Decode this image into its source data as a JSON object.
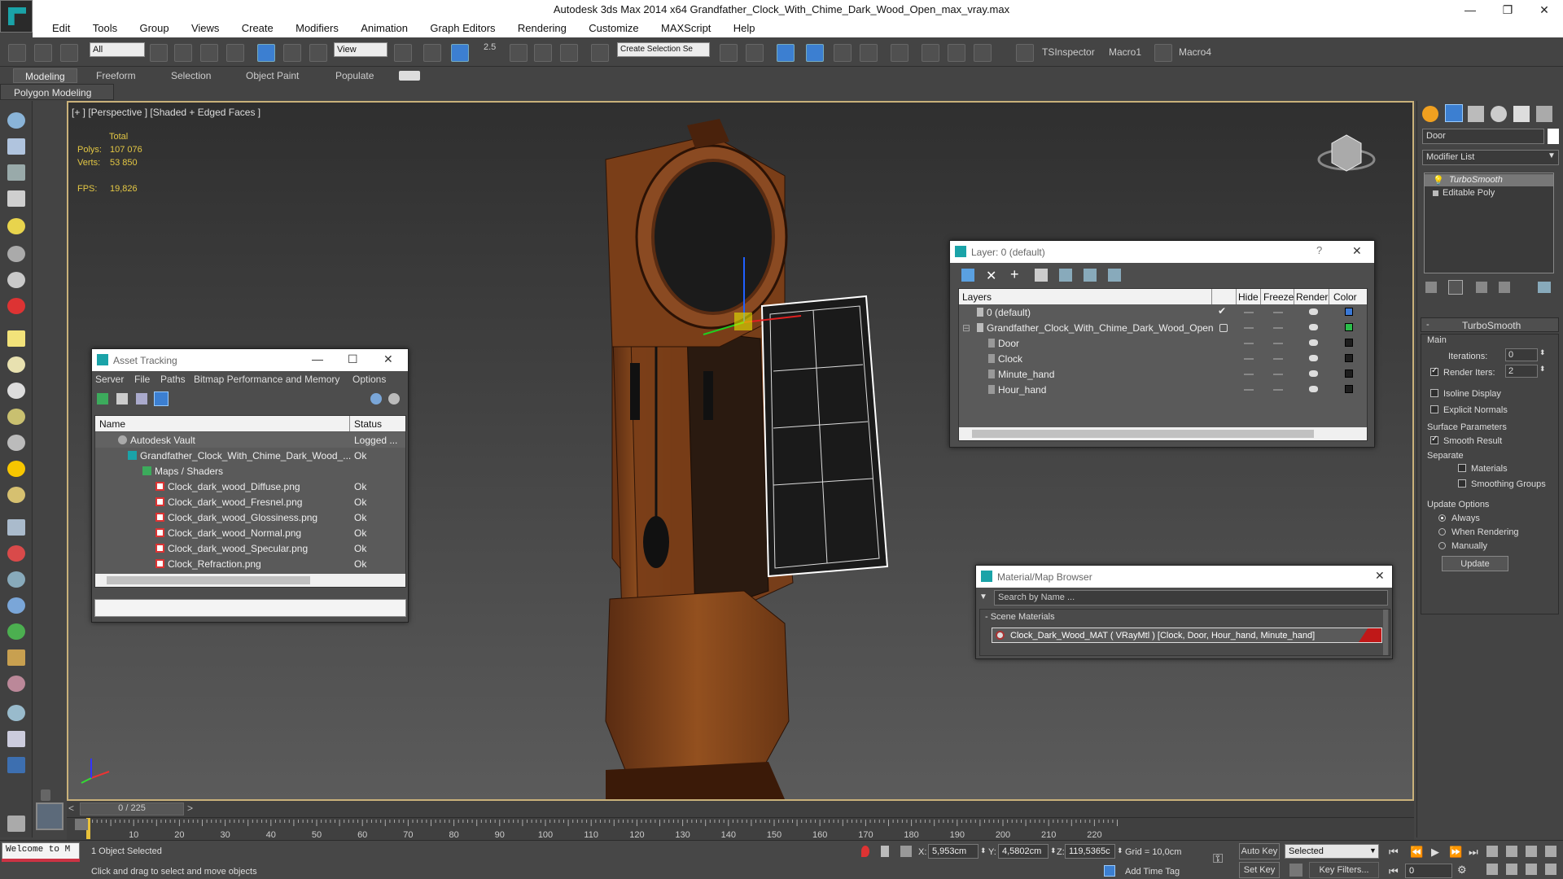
{
  "app": {
    "title": "Autodesk 3ds Max  2014 x64     Grandfather_Clock_With_Chime_Dark_Wood_Open_max_vray.max"
  },
  "menu": [
    "Edit",
    "Tools",
    "Group",
    "Views",
    "Create",
    "Modifiers",
    "Animation",
    "Graph Editors",
    "Rendering",
    "Customize",
    "MAXScript",
    "Help"
  ],
  "toolbar": {
    "filter_select": "All",
    "view_select": "View",
    "snap_label": "2.5",
    "selection_set": "Create Selection Se",
    "ts_inspector": "TSInspector",
    "macro1": "Macro1",
    "macro4": "Macro4"
  },
  "ribbon": {
    "tabs": [
      "Modeling",
      "Freeform",
      "Selection",
      "Object Paint",
      "Populate"
    ],
    "active_tab": "Modeling",
    "subtab": "Polygon Modeling"
  },
  "viewport": {
    "label": "[+ ] [Perspective ] [Shaded + Edged Faces ]",
    "stats": {
      "total_label": "Total",
      "polys_label": "Polys:",
      "polys": "107 076",
      "verts_label": "Verts:",
      "verts": "53 850",
      "fps_label": "FPS:",
      "fps": "19,826"
    }
  },
  "asset_tracking": {
    "title": "Asset Tracking",
    "menu": [
      "Server",
      "File",
      "Paths",
      "Bitmap Performance and Memory",
      "Options"
    ],
    "columns": [
      "Name",
      "Status"
    ],
    "rows": [
      {
        "name": "Autodesk Vault",
        "status": "Logged ..."
      },
      {
        "name": "Grandfather_Clock_With_Chime_Dark_Wood_...",
        "status": "Ok"
      },
      {
        "name": "Maps / Shaders",
        "status": ""
      },
      {
        "name": "Clock_dark_wood_Diffuse.png",
        "status": "Ok"
      },
      {
        "name": "Clock_dark_wood_Fresnel.png",
        "status": "Ok"
      },
      {
        "name": "Clock_dark_wood_Glossiness.png",
        "status": "Ok"
      },
      {
        "name": "Clock_dark_wood_Normal.png",
        "status": "Ok"
      },
      {
        "name": "Clock_dark_wood_Specular.png",
        "status": "Ok"
      },
      {
        "name": "Clock_Refraction.png",
        "status": "Ok"
      }
    ]
  },
  "layer_window": {
    "title": "Layer: 0 (default)",
    "help": "?",
    "columns": [
      "Layers",
      "Hide",
      "Freeze",
      "Render",
      "Color"
    ],
    "rows": [
      {
        "name": "0 (default)",
        "color": "#3a78d6"
      },
      {
        "name": "Grandfather_Clock_With_Chime_Dark_Wood_Open",
        "color": "#2bbd4a"
      },
      {
        "name": "Door",
        "color": "#1e1e1e"
      },
      {
        "name": "Clock",
        "color": "#1e1e1e"
      },
      {
        "name": "Minute_hand",
        "color": "#1e1e1e"
      },
      {
        "name": "Hour_hand",
        "color": "#1e1e1e"
      }
    ]
  },
  "material_browser": {
    "title": "Material/Map Browser",
    "search_placeholder": "Search by Name ...",
    "group": "- Scene Materials",
    "material": "Clock_Dark_Wood_MAT  ( VRayMtl )  [Clock, Door, Hour_hand, Minute_hand]"
  },
  "command_panel": {
    "object_name": "Door",
    "modifier_list": "Modifier List",
    "stack": [
      "TurboSmooth",
      "Editable Poly"
    ],
    "rollout_title": "TurboSmooth",
    "main_label": "Main",
    "iterations_label": "Iterations:",
    "iterations": "0",
    "render_iters_label": "Render Iters:",
    "render_iters": "2",
    "isoline": "Isoline Display",
    "explicit_normals": "Explicit Normals",
    "surface_params": "Surface Parameters",
    "smooth_result": "Smooth Result",
    "separate": "Separate",
    "materials": "Materials",
    "smoothing_groups": "Smoothing Groups",
    "update_options": "Update Options",
    "always": "Always",
    "when_rendering": "When Rendering",
    "manually": "Manually",
    "update_button": "Update"
  },
  "timeline": {
    "frame_readout": "0 / 225",
    "ticks": [
      "10",
      "20",
      "30",
      "40",
      "50",
      "60",
      "70",
      "80",
      "90",
      "100",
      "110",
      "120",
      "130",
      "140",
      "150",
      "160",
      "170",
      "180",
      "190",
      "200",
      "210",
      "220"
    ]
  },
  "status": {
    "welcome": "Welcome to M",
    "selected": "1 Object Selected",
    "prompt": "Click and drag to select and move objects",
    "x_label": "X:",
    "x": "5,953cm",
    "y_label": "Y:",
    "y": "4,5802cm",
    "z_label": "Z:",
    "z": "119,5365c",
    "grid": "Grid = 10,0cm",
    "add_time_tag": "Add Time Tag",
    "auto_key": "Auto Key",
    "selected_dropdown": "Selected",
    "set_key": "Set Key",
    "key_filters": "Key Filters...",
    "frame": "0"
  },
  "colors": {
    "accent": "#3c7fd1",
    "viewport_border": "#c9b17a",
    "wood": "#8a4a22",
    "material_swatch": "#c01818"
  }
}
